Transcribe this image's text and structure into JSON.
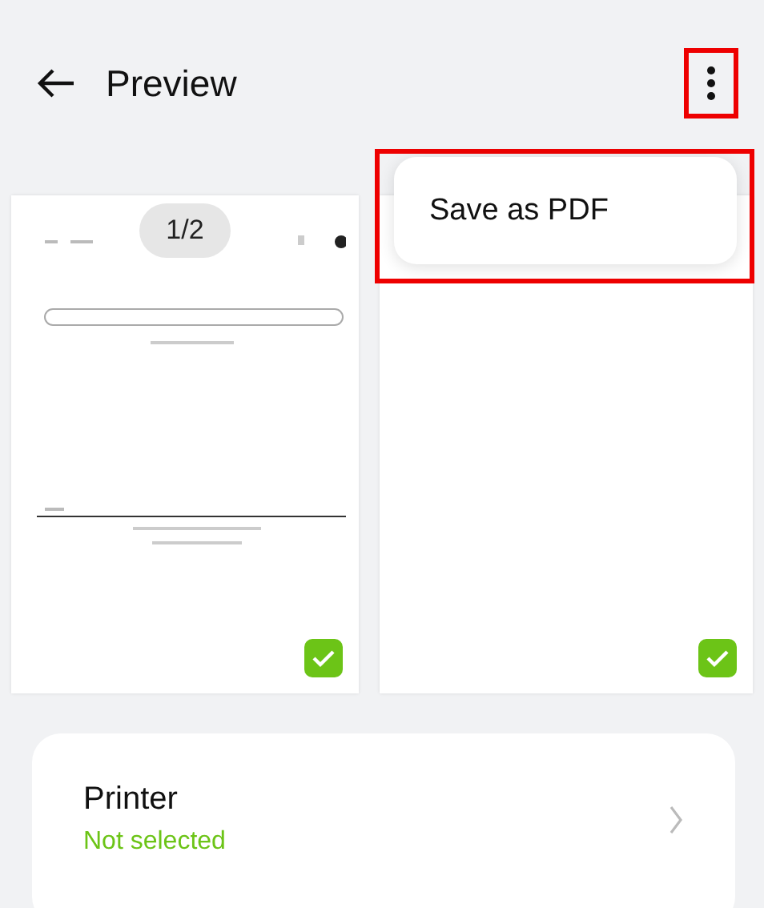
{
  "header": {
    "title": "Preview",
    "menu_highlighted": true
  },
  "page_indicator": "1/2",
  "pages": [
    {
      "selected": true,
      "kind": "search-page"
    },
    {
      "selected": true,
      "kind": "blank"
    }
  ],
  "menu": {
    "items": [
      "Save as PDF"
    ],
    "highlighted": true
  },
  "printer": {
    "label": "Printer",
    "status": "Not selected"
  }
}
